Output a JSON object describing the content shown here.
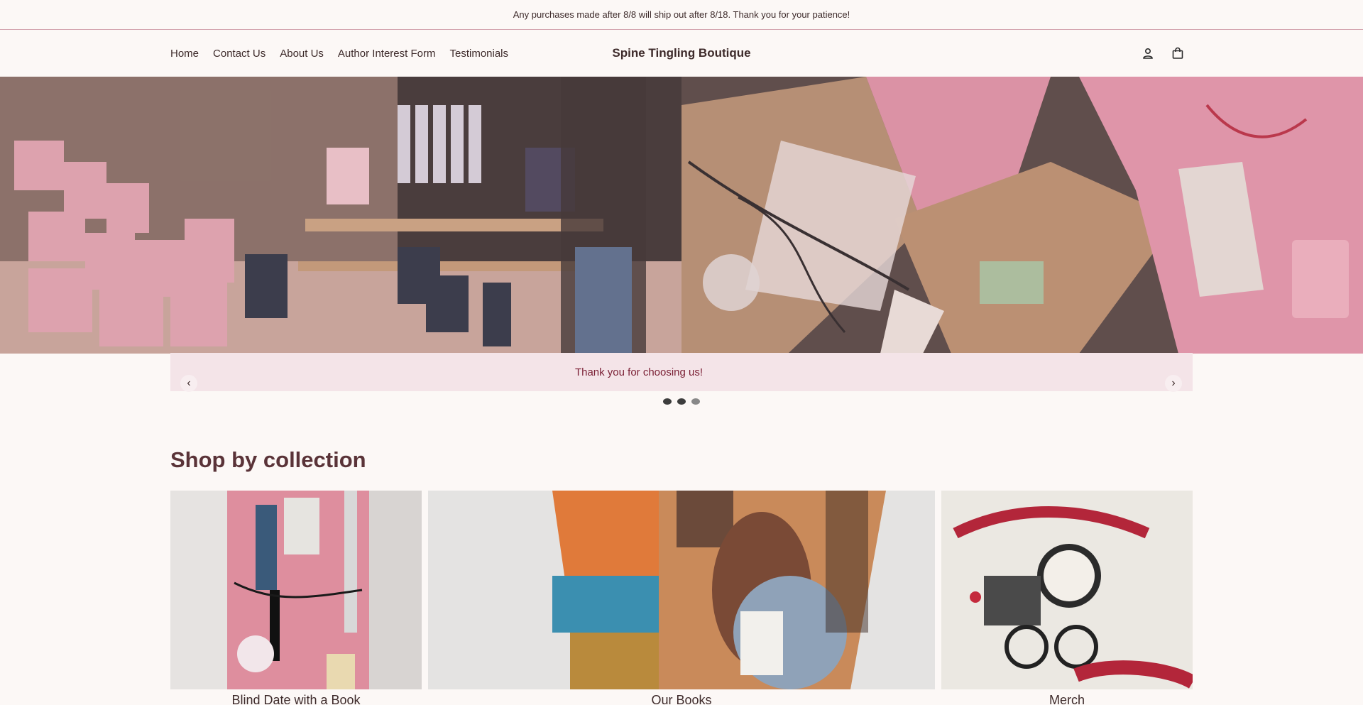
{
  "announcement": "Any purchases made after 8/8 will ship out after 8/18. Thank you for your patience!",
  "header": {
    "nav": [
      {
        "label": "Home"
      },
      {
        "label": "Contact Us"
      },
      {
        "label": "About Us"
      },
      {
        "label": "Author Interest Form"
      },
      {
        "label": "Testimonials"
      }
    ],
    "brand": "Spine Tingling Boutique",
    "icons": [
      "account-icon",
      "cart-icon"
    ]
  },
  "hero": {
    "caption": "Thank you for choosing us!",
    "prev_label": "‹",
    "next_label": "›",
    "slides_total": 3,
    "active_slide": 3
  },
  "collections": {
    "title": "Shop by collection",
    "items": [
      {
        "label": "Blind Date with a Book"
      },
      {
        "label": "Our Books"
      },
      {
        "label": "Merch"
      }
    ]
  },
  "colors": {
    "background": "#fcf8f6",
    "accent": "#7a1f34",
    "caption_bg": "#f4e4e8",
    "border": "#d3a3ad"
  }
}
